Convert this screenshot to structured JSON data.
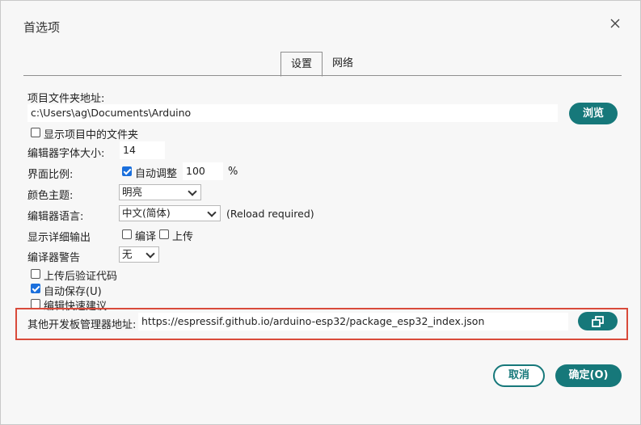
{
  "dialog": {
    "title": "首选项"
  },
  "tabs": [
    {
      "label": "设置"
    },
    {
      "label": "网络"
    }
  ],
  "sketchbook": {
    "label": "项目文件夹地址:",
    "path": "c:\\Users\\ag\\Documents\\Arduino",
    "browse": "浏览"
  },
  "show_files_in_sketch": {
    "label": "显示项目中的文件夹",
    "checked": false
  },
  "editor_font_size": {
    "label": "编辑器字体大小:",
    "value": "14"
  },
  "interface_scale": {
    "label": "界面比例:",
    "auto_label": "自动调整",
    "auto_checked": true,
    "value": "100",
    "unit": "%"
  },
  "theme": {
    "label": "颜色主题:",
    "selected": "明亮"
  },
  "language": {
    "label": "编辑器语言:",
    "selected": "中文(简体)",
    "note": "(Reload required)"
  },
  "verbose": {
    "label": "显示详细输出",
    "compile": "编译",
    "upload": "上传"
  },
  "compiler_warnings": {
    "label": "编译器警告",
    "selected": "无"
  },
  "verify_after_upload": {
    "label": "上传后验证代码",
    "checked": false
  },
  "auto_save": {
    "label": "自动保存(U)",
    "checked": true
  },
  "quick_suggestions": {
    "label": "编辑快速建议",
    "checked": false
  },
  "board_manager": {
    "label": "其他开发板管理器地址:",
    "url": "https://espressif.github.io/arduino-esp32/package_esp32_index.json",
    "icon": "open-window-icon"
  },
  "footer": {
    "cancel": "取消",
    "ok": "确定(O)"
  },
  "colors": {
    "accent": "#16787a",
    "checkbox": "#1a6fdc",
    "highlight": "#d94a3a"
  }
}
